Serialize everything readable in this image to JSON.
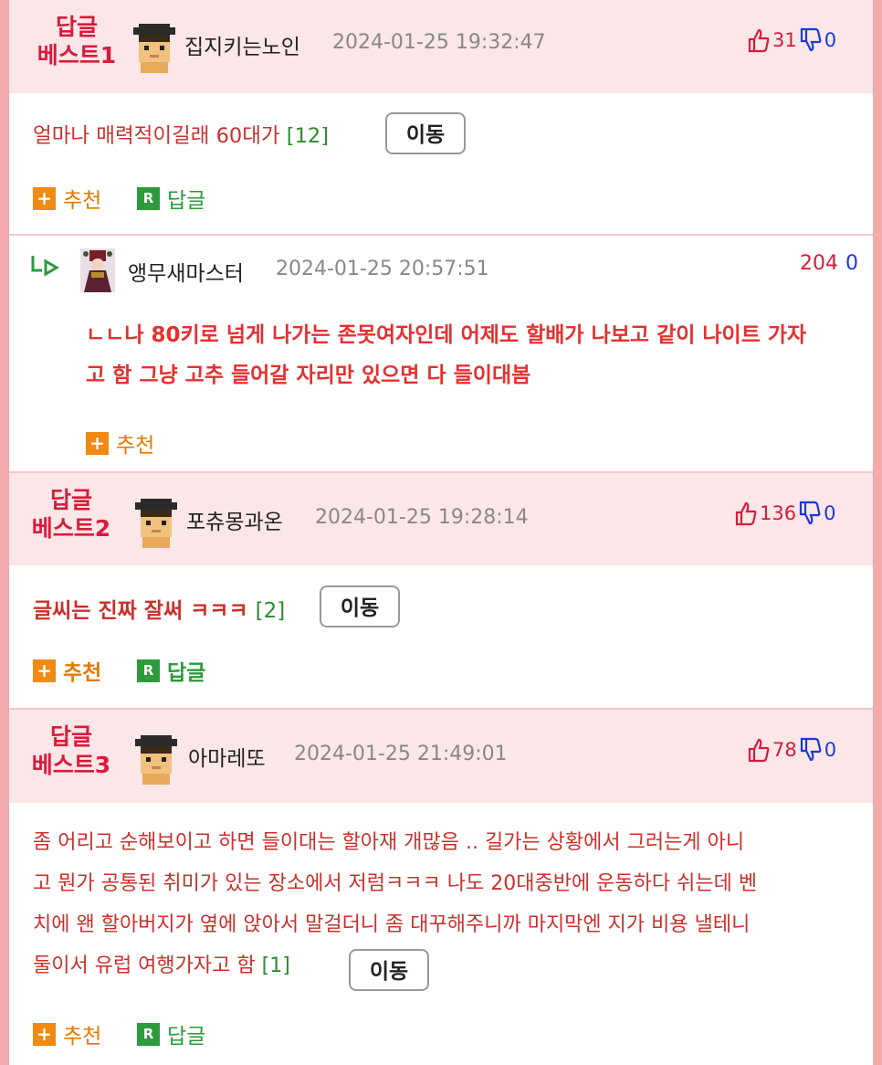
{
  "comments": [
    {
      "best": "답글\n베스트1",
      "best_line1": "답글",
      "best_line2": "베스트1",
      "nick": "집지키는노인",
      "date": "2024-01-25 19:32:47",
      "up": "31",
      "down": "0",
      "text": "얼마나 매력적이길래 60대가",
      "count": "[12]",
      "move": "이동",
      "recommend": "추천",
      "reply": "답글"
    },
    {
      "best_line1": "답글",
      "best_line2": "베스트2",
      "nick": "포츄몽과온",
      "date": "2024-01-25 19:28:14",
      "up": "136",
      "down": "0",
      "text": "글씨는 진짜 잘써 ㅋㅋㅋ",
      "count": "[2]",
      "move": "이동",
      "recommend": "추천",
      "reply": "답글"
    },
    {
      "best_line1": "답글",
      "best_line2": "베스트3",
      "nick": "아마레또",
      "date": "2024-01-25 21:49:01",
      "up": "78",
      "down": "0",
      "lines": [
        "좀 어리고 순해보이고 하면 들이대는 할아재 개많음 .. 길가는 상황에서 그러는게 아니",
        "고 뭔가 공통된 취미가 있는 장소에서 저럼ㅋㅋㅋ 나도 20대중반에 운동하다 쉬는데 벤",
        "치에 왠 할아버지가 옆에 앉아서 말걸더니 좀 대꾸해주니까 마지막엔 지가 비용 낼테니",
        "둘이서 유럽 여행가자고 함"
      ],
      "count": "[1]",
      "move": "이동",
      "recommend": "추천",
      "reply": "답글"
    }
  ],
  "reply": {
    "arrow": "L▷",
    "nick": "앵무새마스터",
    "date": "2024-01-25 20:57:51",
    "up": "204",
    "down": "0",
    "lines": [
      "ㄴㄴ나 80키로 넘게 나가는 존못여자인데 어제도 할배가 나보고 같이 나이트 가자",
      "고 함 그냥 고추 들어갈 자리만 있으면 다 들이대봄"
    ],
    "recommend": "추천"
  },
  "colors": {
    "accent_red": "#d81b3b",
    "down_blue": "#1a3ad8",
    "header_bg": "#fbe6e8",
    "page_border": "#f4a9ad"
  }
}
